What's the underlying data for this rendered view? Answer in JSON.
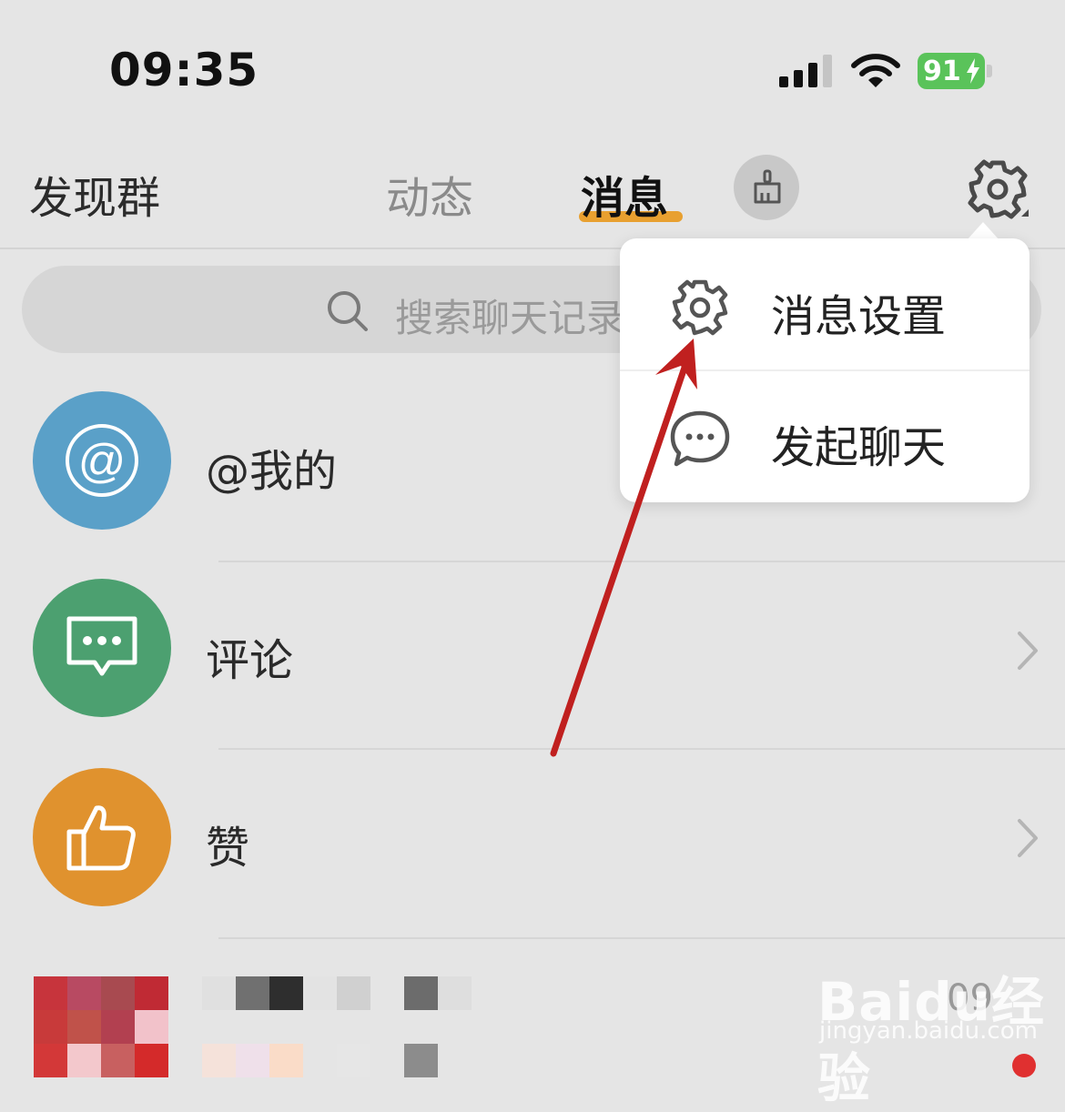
{
  "status_bar": {
    "time": "09:35",
    "battery": "91"
  },
  "tabs": [
    {
      "label": "发现群"
    },
    {
      "label": "动态"
    },
    {
      "label": "消息",
      "active": true
    }
  ],
  "search": {
    "placeholder": "搜索聊天记录"
  },
  "list": [
    {
      "label": "@我的",
      "icon": "at-icon",
      "color": "#5aa0c8"
    },
    {
      "label": "评论",
      "icon": "comment-icon",
      "color": "#4ca070"
    },
    {
      "label": "赞",
      "icon": "thumbs-up-icon",
      "color": "#e0922e"
    }
  ],
  "contact_row": {
    "time": "09"
  },
  "popup_menu": {
    "items": [
      {
        "label": "消息设置",
        "icon": "gear-icon"
      },
      {
        "label": "发起聊天",
        "icon": "chat-bubble-icon"
      }
    ]
  },
  "watermark": {
    "main": "Baidu经验",
    "sub": "jingyan.baidu.com"
  },
  "colors": {
    "accent": "#e8a030",
    "annotation_arrow": "#c0201f",
    "battery": "#5ac35a"
  }
}
